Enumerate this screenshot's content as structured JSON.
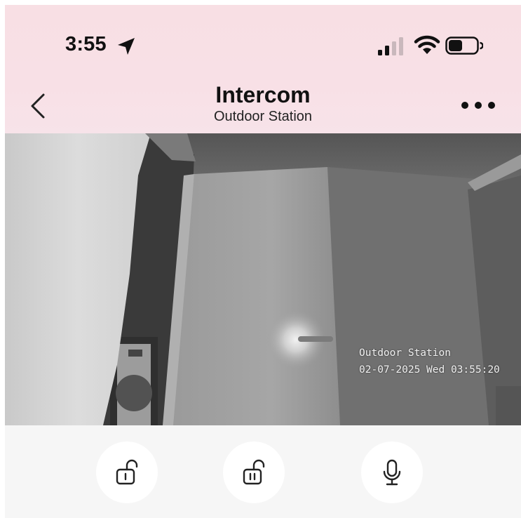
{
  "status_bar": {
    "time": "3:55"
  },
  "header": {
    "title": "Intercom",
    "subtitle": "Outdoor Station"
  },
  "video": {
    "overlay_station": "Outdoor Station",
    "overlay_timestamp": "02-07-2025 Wed 03:55:20"
  },
  "controls": [
    {
      "name": "unlock-1",
      "icon": "unlock-icon"
    },
    {
      "name": "unlock-2",
      "icon": "unlock-icon"
    },
    {
      "name": "microphone",
      "icon": "microphone-icon"
    }
  ]
}
